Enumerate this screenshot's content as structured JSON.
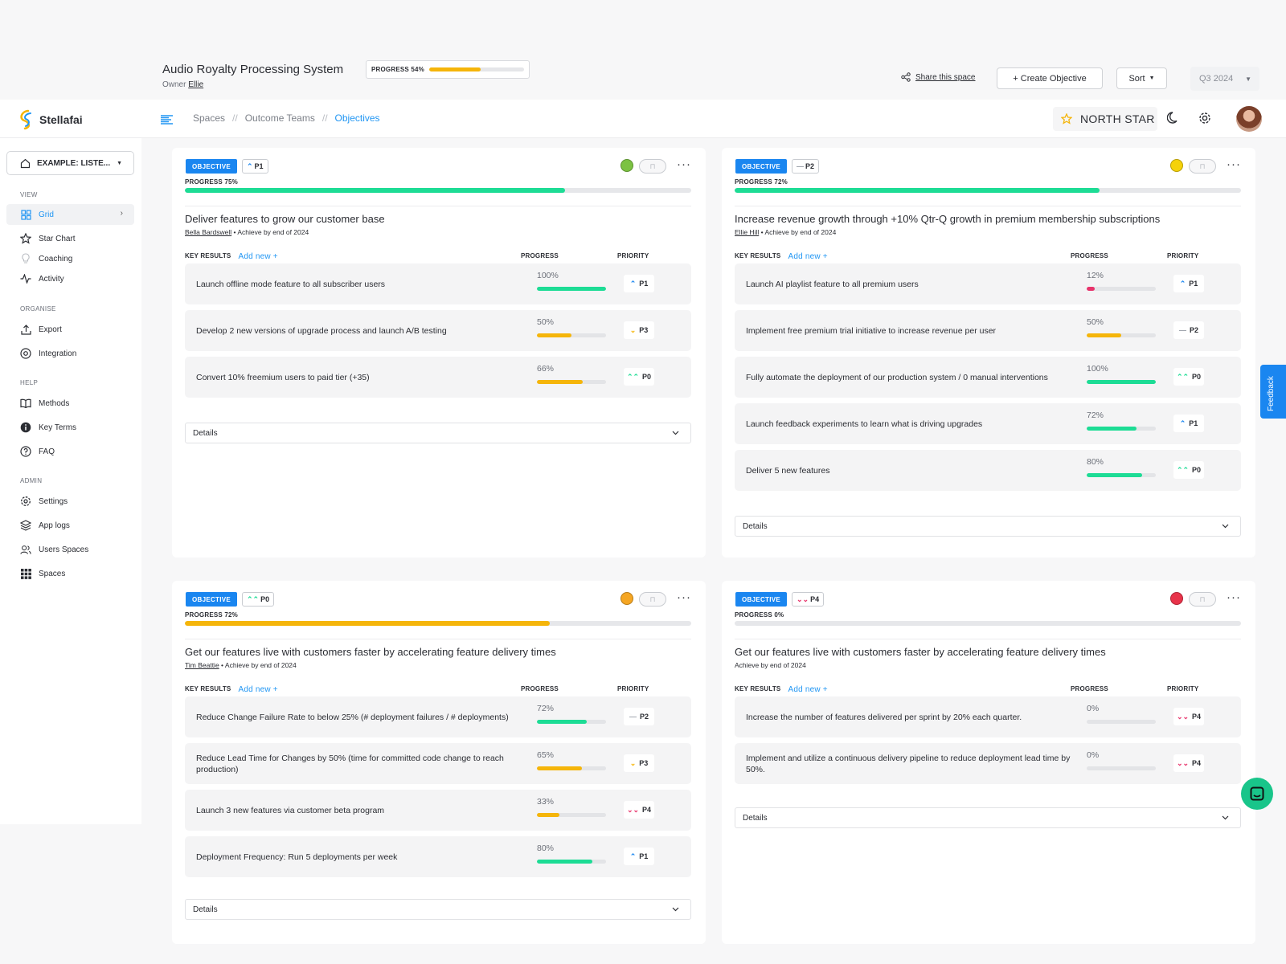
{
  "project": {
    "title": "Audio Royalty Processing System",
    "owner_label": "Owner",
    "owner_name": "Ellie",
    "progress_label": "PROGRESS 54%",
    "progress": 54
  },
  "header": {
    "share_label": "Share this space",
    "create_label": "+ Create Objective",
    "sort_label": "Sort",
    "quarter": "Q3 2024"
  },
  "nav": {
    "logo": "Stellafai",
    "crumbs": [
      "Spaces",
      "Outcome Teams",
      "Objectives"
    ],
    "sep": "//",
    "north_star": "NORTH STAR"
  },
  "sidebar": {
    "space": "EXAMPLE: LISTE...",
    "sections": {
      "view": "VIEW",
      "organise": "ORGANISE",
      "help": "HELP",
      "admin": "ADMIN"
    },
    "items": [
      "Grid",
      "Star Chart",
      "Coaching",
      "Activity",
      "Export",
      "Integration",
      "Methods",
      "Key Terms",
      "FAQ",
      "Settings",
      "App logs",
      "Users Spaces",
      "Spaces"
    ]
  },
  "labels": {
    "objective": "OBJECTIVE",
    "key_results": "KEY RESULTS",
    "add_new": "Add new +",
    "progress": "PROGRESS",
    "priority": "PRIORITY",
    "details": "Details",
    "feedback": "Feedback"
  },
  "colors": {
    "accent": "#2196f3",
    "green": "#1ddc95",
    "yellow": "#f5b50a",
    "red": "#e8336b"
  },
  "cards": [
    {
      "priority": "P1",
      "mood": "happy",
      "progress_label": "PROGRESS 75%",
      "progress": 75,
      "title": "Deliver features to grow our customer base",
      "owner": "Bella Bardswell",
      "achieve": " • Achieve by end of 2024",
      "krs": [
        {
          "text": "Launch offline mode feature to all subscriber users",
          "pct": "100%",
          "value": 100,
          "priority": "P1"
        },
        {
          "text": "Develop 2 new versions of upgrade process and launch A/B testing",
          "pct": "50%",
          "value": 50,
          "priority": "P3"
        },
        {
          "text": "Convert 10% freemium users to paid tier (+35)",
          "pct": "66%",
          "value": 66,
          "priority": "P0"
        }
      ]
    },
    {
      "priority": "P2",
      "mood": "neutral",
      "progress_label": "PROGRESS 72%",
      "progress": 72,
      "title": "Increase revenue growth through +10% Qtr-Q growth in premium membership subscriptions",
      "owner": "Ellie Hill",
      "achieve": " • Achieve by end of 2024",
      "krs": [
        {
          "text": "Launch AI playlist feature to all premium users",
          "pct": "12%",
          "value": 12,
          "priority": "P1"
        },
        {
          "text": "Implement free premium trial initiative to increase revenue per user",
          "pct": "50%",
          "value": 50,
          "priority": "P2"
        },
        {
          "text": "Fully automate the deployment of our production system / 0 manual interventions",
          "pct": "100%",
          "value": 100,
          "priority": "P0"
        },
        {
          "text": "Launch feedback experiments to learn what is driving upgrades",
          "pct": "72%",
          "value": 72,
          "priority": "P1"
        },
        {
          "text": "Deliver 5 new features",
          "pct": "80%",
          "value": 80,
          "priority": "P0"
        }
      ]
    },
    {
      "priority": "P0",
      "mood": "sad",
      "progress_label": "PROGRESS 72%",
      "progress": 72,
      "title": "Get our features live with customers faster by accelerating feature delivery times",
      "owner": "Tim Beattie",
      "achieve": " • Achieve by end of 2024",
      "krs": [
        {
          "text": "Reduce Change Failure Rate to below 25% (# deployment failures / # deployments)",
          "pct": "72%",
          "value": 72,
          "priority": "P2"
        },
        {
          "text": "Reduce Lead Time for Changes by 50% (time for committed code change to reach production)",
          "pct": "65%",
          "value": 65,
          "priority": "P3"
        },
        {
          "text": "Launch 3 new features via customer beta program",
          "pct": "33%",
          "value": 33,
          "priority": "P4"
        },
        {
          "text": "Deployment Frequency: Run 5 deployments per week",
          "pct": "80%",
          "value": 80,
          "priority": "P1"
        }
      ]
    },
    {
      "priority": "P4",
      "mood": "angry",
      "progress_label": "PROGRESS 0%",
      "progress": 0,
      "title": "Get our features live with customers faster by accelerating feature delivery times",
      "owner": "",
      "achieve": "Achieve by end of 2024",
      "krs": [
        {
          "text": "Increase the number of features delivered per sprint by 20% each quarter.",
          "pct": "0%",
          "value": 0,
          "priority": "P4"
        },
        {
          "text": "Implement and utilize a continuous delivery pipeline to reduce deployment lead time by 50%.",
          "pct": "0%",
          "value": 0,
          "priority": "P4"
        }
      ]
    }
  ]
}
